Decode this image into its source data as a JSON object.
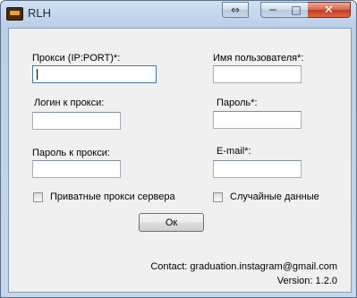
{
  "window": {
    "title": "RLH",
    "controls": {
      "swap": "⇔",
      "minimize": "─",
      "maximize": "□",
      "close": "✕"
    }
  },
  "form": {
    "proxy_label": "Прокси (IP:PORT)*:",
    "proxy_value": "",
    "proxy_login_label": "Логин к прокси:",
    "proxy_login_value": "",
    "proxy_password_label": "Пароль к прокси:",
    "proxy_password_value": "",
    "username_label": "Имя пользователя*:",
    "username_value": "",
    "password_label": "Пароль*:",
    "password_value": "",
    "email_label": "E-mail*:",
    "email_value": "",
    "private_proxy_label": "Приватные прокси сервера",
    "private_proxy_checked": false,
    "random_data_label": "Случайные данные",
    "random_data_checked": false,
    "ok_label": "Ок"
  },
  "footer": {
    "contact": "Contact: graduation.instagram@gmail.com",
    "version": "Version: 1.2.0"
  }
}
